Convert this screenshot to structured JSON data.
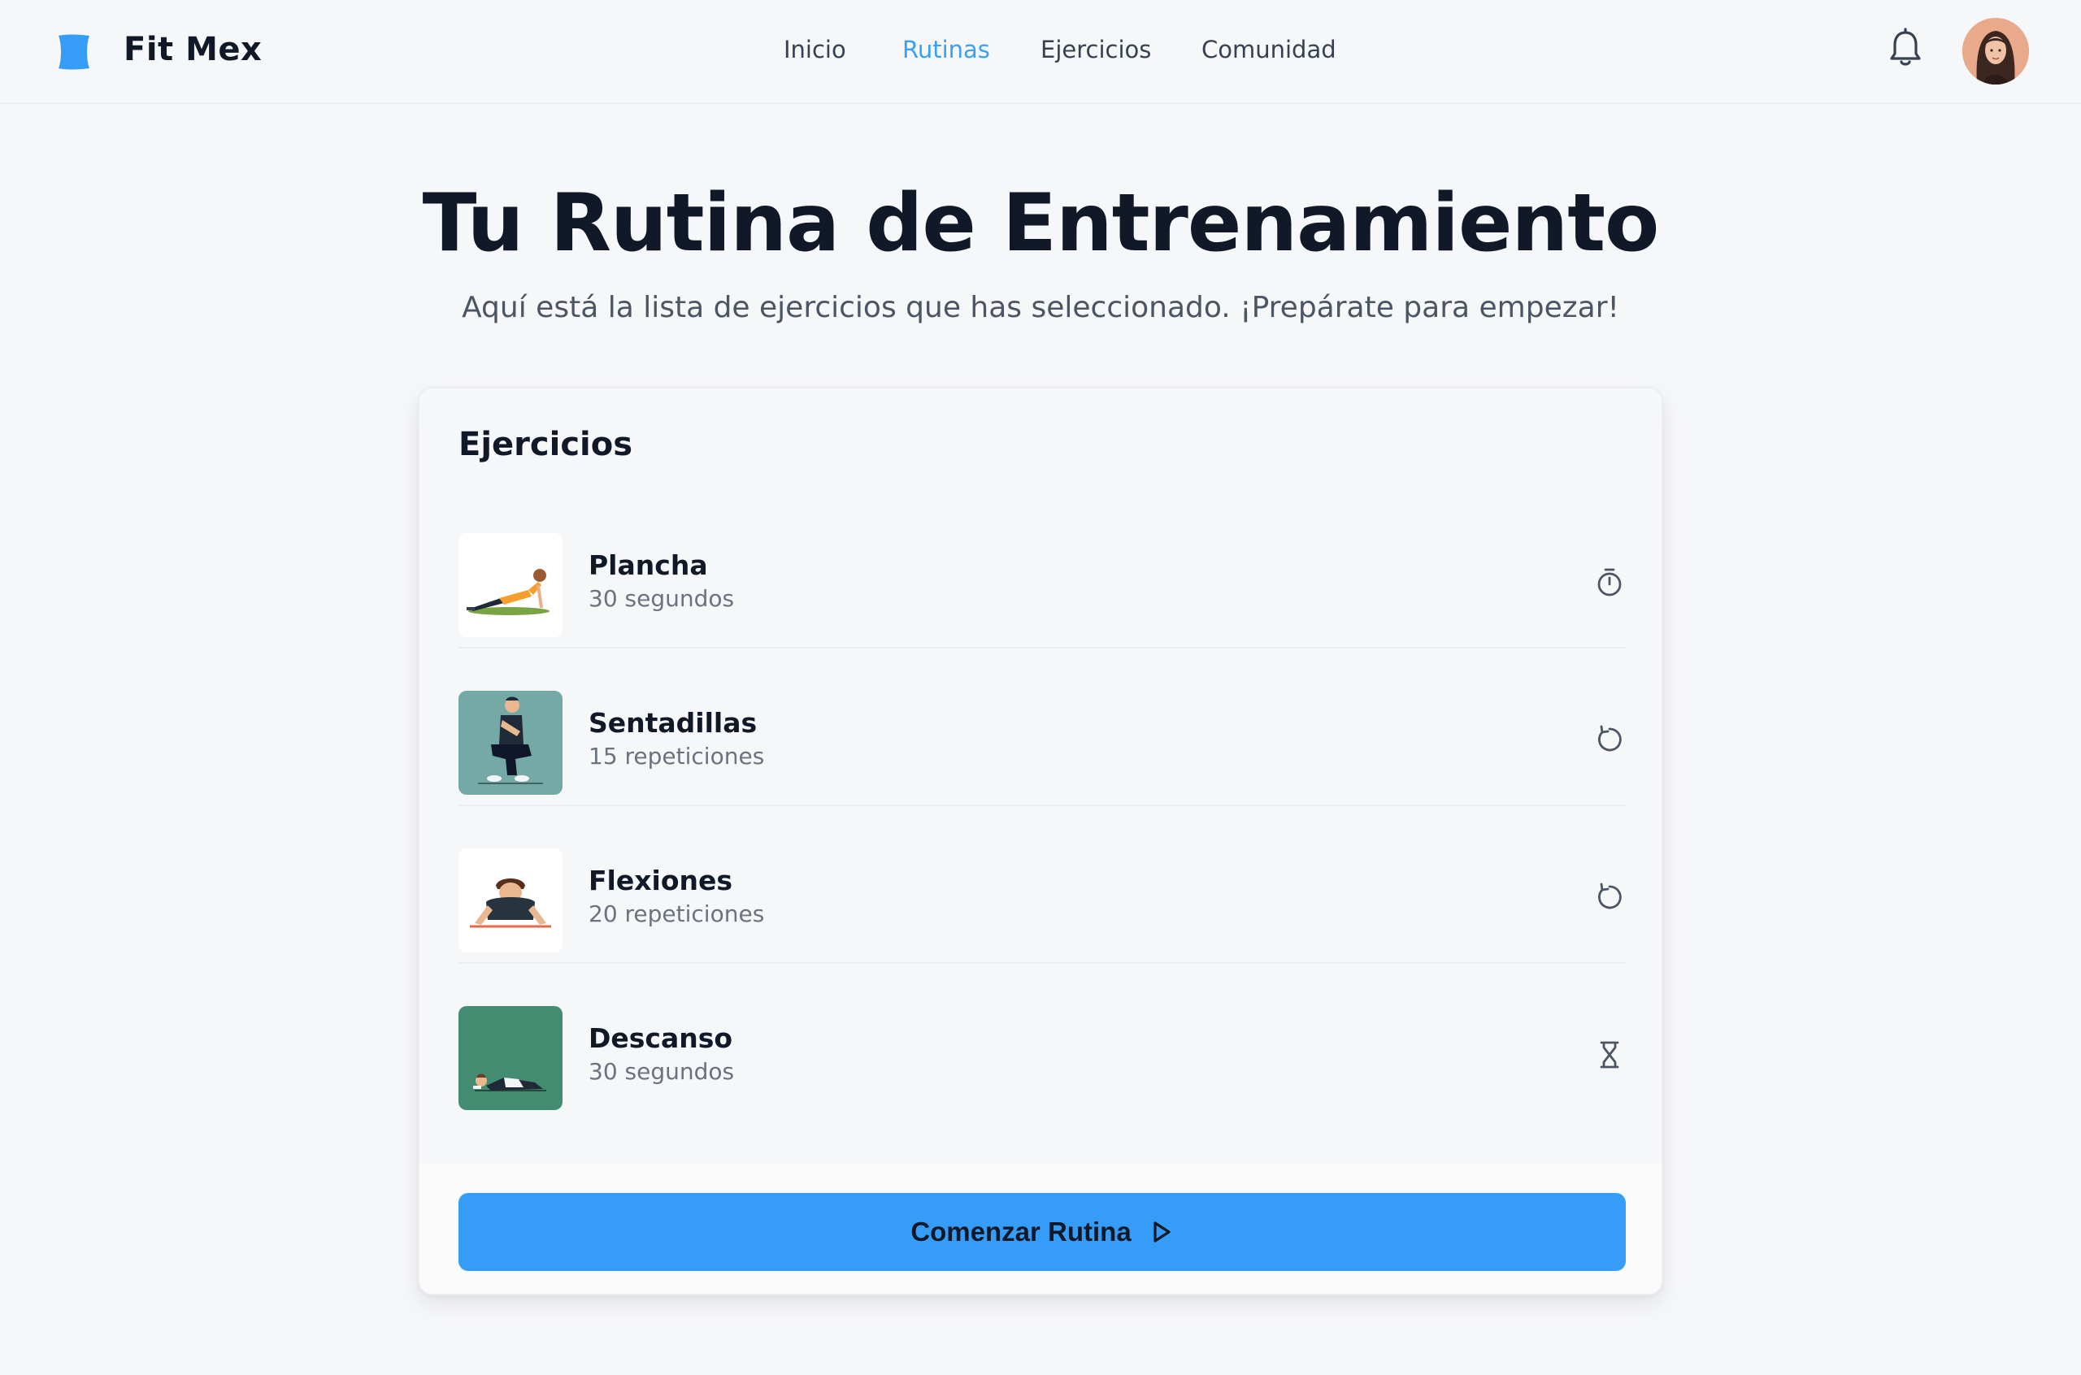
{
  "header": {
    "brand": "Fit Mex",
    "nav": [
      "Inicio",
      "Rutinas",
      "Ejercicios",
      "Comunidad"
    ],
    "active_nav": "Rutinas",
    "brand_color": "#359df8"
  },
  "hero": {
    "title": "Tu Rutina de Entrenamiento",
    "subtitle": "Aquí está la lista de ejercicios que has seleccionado. ¡Prepárate para empezar!"
  },
  "card": {
    "title": "Ejercicios",
    "exercises": [
      {
        "name": "Plancha",
        "meta": "30 segundos",
        "icon": "stopwatch-icon"
      },
      {
        "name": "Sentadillas",
        "meta": "15 repeticiones",
        "icon": "repeat-icon"
      },
      {
        "name": "Flexiones",
        "meta": "20 repeticiones",
        "icon": "repeat-icon"
      },
      {
        "name": "Descanso",
        "meta": "30 segundos",
        "icon": "hourglass-icon"
      }
    ],
    "start_button": "Comenzar Rutina"
  }
}
